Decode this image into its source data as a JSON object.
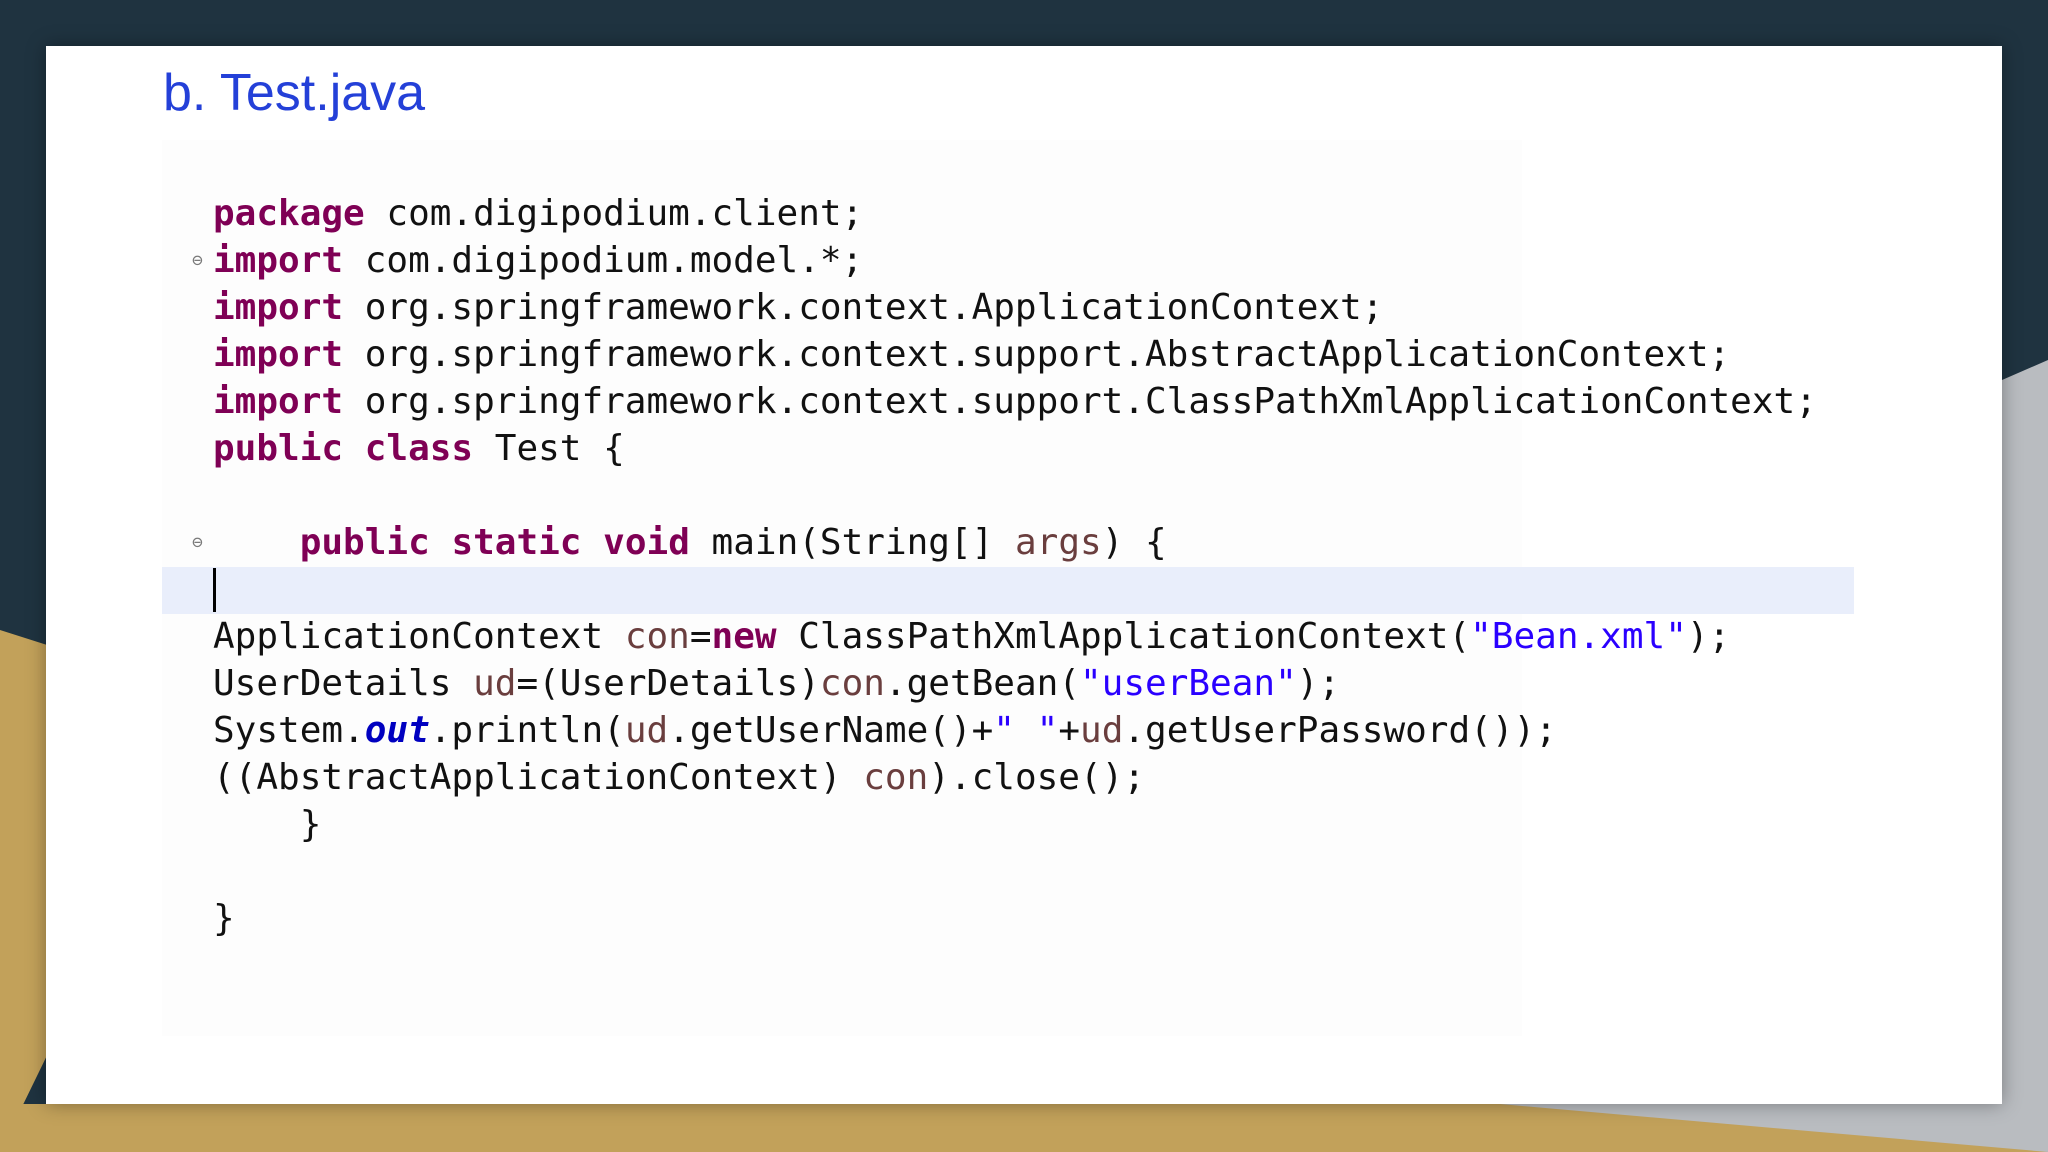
{
  "slide": {
    "title": "b. Test.java"
  },
  "colors": {
    "title": "#2440d8",
    "keyword": "#7f0055",
    "string": "#2a00ff",
    "variable": "#6a3e3e",
    "static_field": "#0000c0",
    "current_line_highlight": "#e9eefb",
    "background_dark": "#1f3340",
    "background_gold": "#c2a15a"
  },
  "code": {
    "lines": [
      [
        {
          "t": "kw",
          "s": "package"
        },
        {
          "t": "p",
          "s": " com.digipodium.client;"
        }
      ],
      [
        {
          "t": "kw",
          "s": "import"
        },
        {
          "t": "p",
          "s": " com.digipodium.model.*;"
        }
      ],
      [
        {
          "t": "kw",
          "s": "import"
        },
        {
          "t": "p",
          "s": " org.springframework.context.ApplicationContext;"
        }
      ],
      [
        {
          "t": "kw",
          "s": "import"
        },
        {
          "t": "p",
          "s": " org.springframework.context.support.AbstractApplicationContext;"
        }
      ],
      [
        {
          "t": "kw",
          "s": "import"
        },
        {
          "t": "p",
          "s": " org.springframework.context.support.ClassPathXmlApplicationContext;"
        }
      ],
      [
        {
          "t": "kw",
          "s": "public"
        },
        {
          "t": "p",
          "s": " "
        },
        {
          "t": "kw",
          "s": "class"
        },
        {
          "t": "p",
          "s": " Test {"
        }
      ],
      [],
      [
        {
          "t": "p",
          "s": "    "
        },
        {
          "t": "kw",
          "s": "public"
        },
        {
          "t": "p",
          "s": " "
        },
        {
          "t": "kw",
          "s": "static"
        },
        {
          "t": "p",
          "s": " "
        },
        {
          "t": "kw",
          "s": "void"
        },
        {
          "t": "p",
          "s": " main(String[] "
        },
        {
          "t": "param",
          "s": "args"
        },
        {
          "t": "p",
          "s": ") {"
        }
      ],
      [],
      [
        {
          "t": "p",
          "s": "ApplicationContext "
        },
        {
          "t": "var",
          "s": "con"
        },
        {
          "t": "p",
          "s": "="
        },
        {
          "t": "kw",
          "s": "new"
        },
        {
          "t": "p",
          "s": " ClassPathXmlApplicationContext("
        },
        {
          "t": "str",
          "s": "\"Bean.xml\""
        },
        {
          "t": "p",
          "s": ");"
        }
      ],
      [
        {
          "t": "p",
          "s": "UserDetails "
        },
        {
          "t": "var",
          "s": "ud"
        },
        {
          "t": "p",
          "s": "=(UserDetails)"
        },
        {
          "t": "var",
          "s": "con"
        },
        {
          "t": "p",
          "s": ".getBean("
        },
        {
          "t": "str",
          "s": "\"userBean\""
        },
        {
          "t": "p",
          "s": ");"
        }
      ],
      [
        {
          "t": "p",
          "s": "System."
        },
        {
          "t": "fld",
          "s": "out"
        },
        {
          "t": "p",
          "s": ".println("
        },
        {
          "t": "var",
          "s": "ud"
        },
        {
          "t": "p",
          "s": ".getUserName()+"
        },
        {
          "t": "str",
          "s": "\" \""
        },
        {
          "t": "p",
          "s": "+"
        },
        {
          "t": "var",
          "s": "ud"
        },
        {
          "t": "p",
          "s": ".getUserPassword());"
        }
      ],
      [
        {
          "t": "p",
          "s": "((AbstractApplicationContext) "
        },
        {
          "t": "var",
          "s": "con"
        },
        {
          "t": "p",
          "s": ").close();"
        }
      ],
      [
        {
          "t": "p",
          "s": "    }"
        }
      ],
      [],
      [
        {
          "t": "p",
          "s": "}"
        }
      ]
    ],
    "gutter_markers": [
      {
        "line": 1,
        "glyph": "⊖"
      },
      {
        "line": 7,
        "glyph": "⊖"
      }
    ]
  }
}
